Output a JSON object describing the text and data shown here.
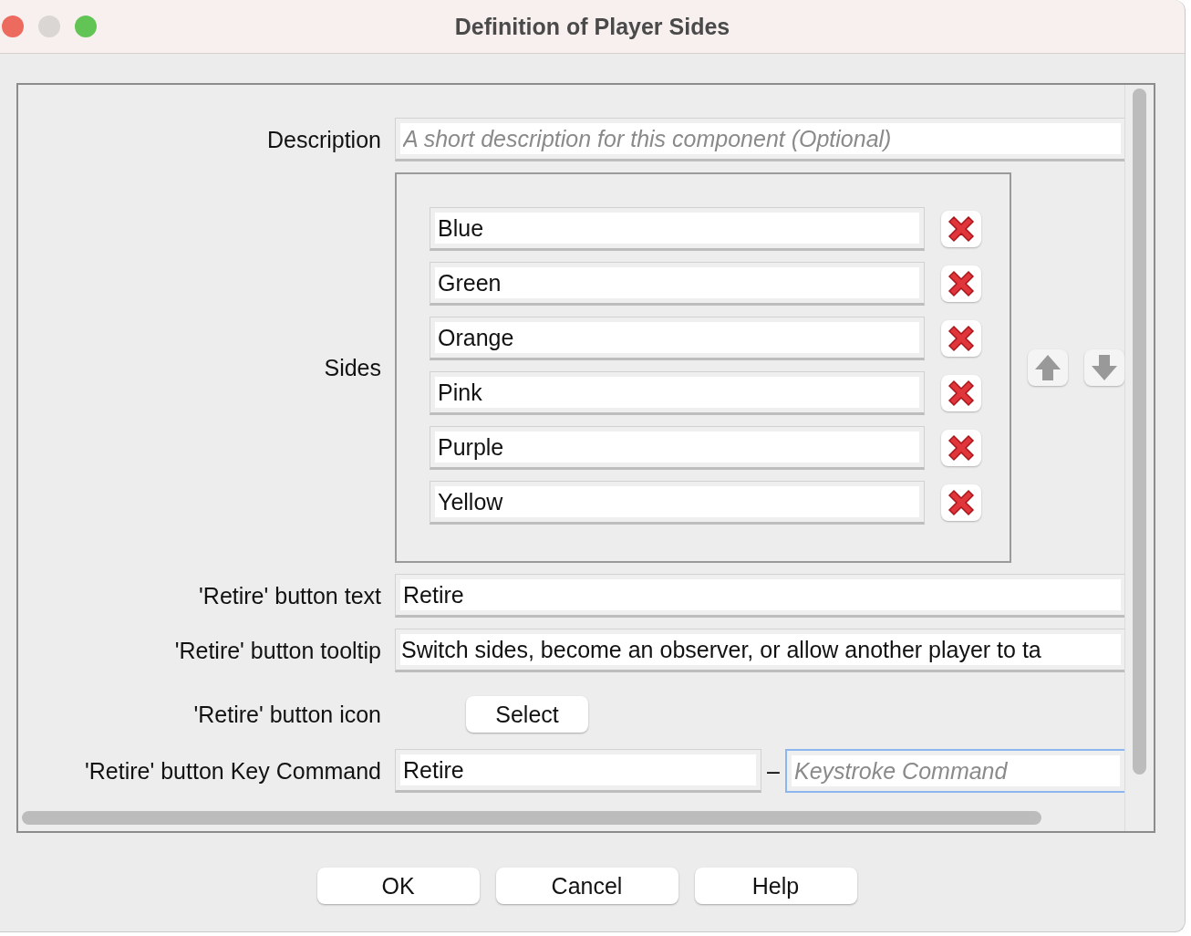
{
  "window": {
    "title": "Definition of Player Sides"
  },
  "description": {
    "label": "Description",
    "placeholder": "A short description for this component (Optional)"
  },
  "sides": {
    "label": "Sides",
    "items": [
      {
        "name": "Blue"
      },
      {
        "name": "Green"
      },
      {
        "name": "Orange"
      },
      {
        "name": "Pink"
      },
      {
        "name": "Purple"
      },
      {
        "name": "Yellow"
      }
    ]
  },
  "retire_text": {
    "label": "'Retire' button text",
    "value": "Retire"
  },
  "retire_tooltip": {
    "label": "'Retire' button tooltip",
    "value": "Switch sides, become an observer, or allow another player to ta"
  },
  "retire_icon": {
    "label": "'Retire' button icon",
    "button": "Select"
  },
  "retire_key": {
    "label": "'Retire' button Key Command",
    "value": "Retire",
    "separator": "–",
    "placeholder": "Keystroke Command",
    "focused": true
  },
  "buttons": [
    "OK",
    "Cancel",
    "Help"
  ]
}
